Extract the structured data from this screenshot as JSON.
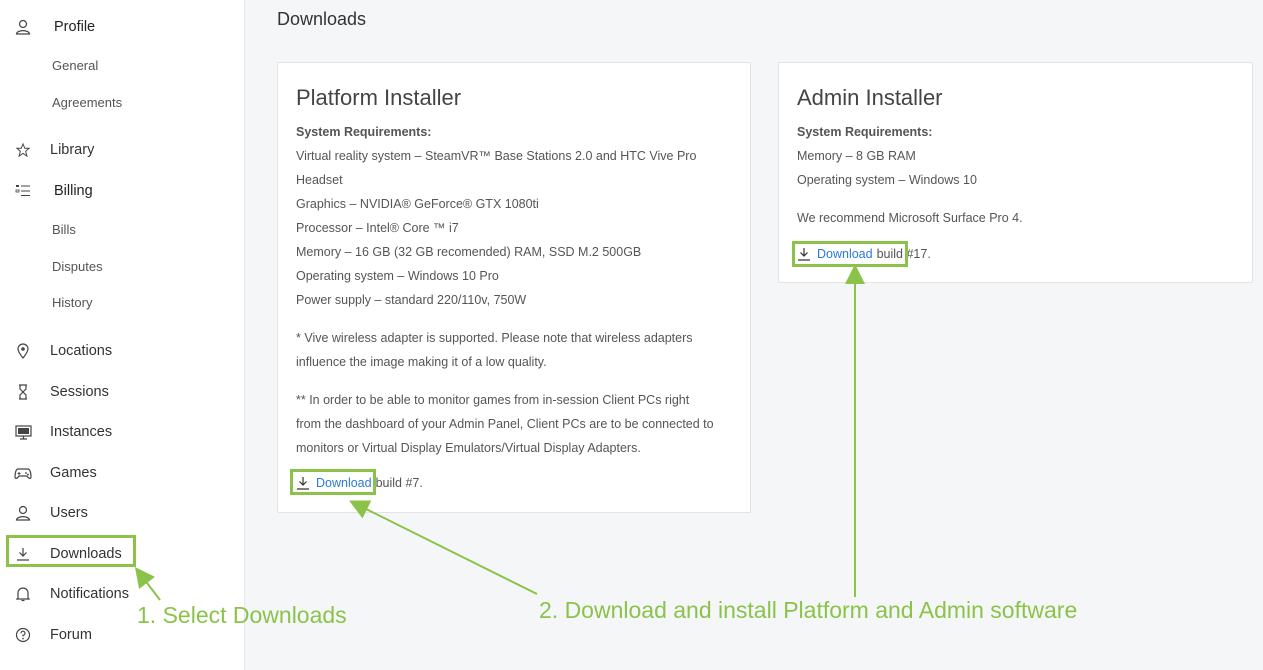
{
  "sidebar": {
    "profile": "Profile",
    "profile_sub": [
      "General",
      "Agreements"
    ],
    "library": "Library",
    "billing": "Billing",
    "billing_sub": [
      "Bills",
      "Disputes",
      "History"
    ],
    "locations": "Locations",
    "sessions": "Sessions",
    "instances": "Instances",
    "games": "Games",
    "users": "Users",
    "downloads": "Downloads",
    "notifications": "Notifications",
    "forum": "Forum"
  },
  "main": {
    "title": "Downloads",
    "platform": {
      "title": "Platform Installer",
      "req_title": "System Requirements:",
      "lines": [
        "Virtual reality system – SteamVR™ Base Stations 2.0 and HTC Vive Pro",
        "Headset",
        "Graphics – NVIDIA® GeForce® GTX 1080ti",
        "Processor – Intel® Core ™ i7",
        "Memory – 16 GB (32 GB recomended) RAM, SSD M.2 500GB",
        "Operating system – Windows 10 Pro",
        "Power supply – standard 220/110v, 750W"
      ],
      "note1": [
        "* Vive wireless adapter is supported. Please note that wireless adapters",
        "influence the image making it of a low quality."
      ],
      "note2": [
        "** In order to be able to monitor games from in-session Client PCs right",
        "from the dashboard of your Admin Panel, Client PCs are to be connected to",
        "monitors or Virtual Display Emulators/Virtual Display Adapters."
      ],
      "download_link": "Download",
      "download_suffix": "build #7."
    },
    "admin": {
      "title": "Admin Installer",
      "req_title": "System Requirements:",
      "lines": [
        "Memory – 8 GB RAM",
        "Operating system – Windows 10"
      ],
      "recommend": "We recommend Microsoft Surface Pro 4.",
      "download_link": "Download",
      "download_suffix": "build #17."
    }
  },
  "annotations": {
    "step1": "1. Select Downloads",
    "step2": "2. Download and install Platform and Admin software",
    "color": "#8bc34a"
  },
  "colors": {
    "link": "#2a7ad6",
    "highlight": "#8bc34a"
  }
}
